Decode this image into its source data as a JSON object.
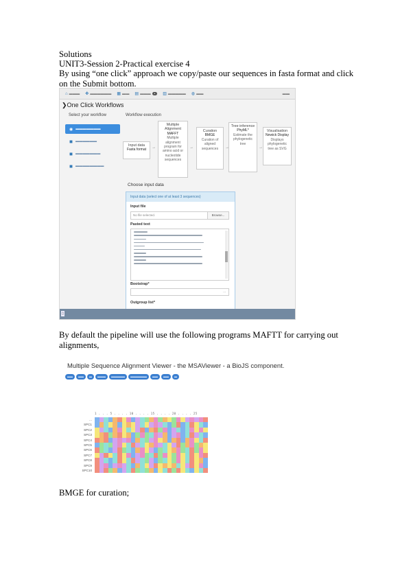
{
  "document": {
    "heading": "Solutions",
    "subheading": "UNIT3-Session 2-Practical exercise 4",
    "intro": "By using “one click” approach we copy/paste our sequences in fasta format and click on the Submit bottom.",
    "pipeline_text": "By default the pipeline will use the following programs MAFTT for carrying out alignments,",
    "bmge_text": "BMGE for curation;"
  },
  "screenshot1": {
    "page_title": "One Click Workflows",
    "sidebar_title": "Select your workflow",
    "workflow_title": "Workflow execution",
    "input_label": "Choose input data",
    "panel_header": "Input data (select one of at least 3 sequences)",
    "input_file_label": "Input file",
    "file_placeholder": "No file selected.",
    "file_button": "Browse...",
    "pasted_label": "Pasted text",
    "bootstrap_label": "Bootstrap*",
    "bootstrap_value": "...",
    "outgroup_label": "Outgroup list*",
    "colors": {
      "accent": "#3c8dde",
      "panel_border": "#a8cbe8",
      "bottom_bar": "#7389a1"
    },
    "workflow_steps": [
      {
        "step": "Input data",
        "program": "Fasta format",
        "desc": ""
      },
      {
        "step": "Multiple Alignment",
        "program": "MAFFT",
        "desc": "Multiple alignment program for amino acid or nucleotide sequences"
      },
      {
        "step": "Curation",
        "program": "BMGE",
        "desc": "Curation of aligned sequences"
      },
      {
        "step": "Tree inference",
        "program": "PhyML*",
        "desc": "Estimate the phylogenetic tree"
      },
      {
        "step": "Visualisation",
        "program": "Newick Display",
        "desc": "Displays phylogenetic tree as SVG"
      }
    ]
  },
  "screenshot2": {
    "title": "Multiple Sequence Alignment Viewer - the MSAViewer - a BioJS component.",
    "seq_names": [
      "...",
      "SPC1",
      "SPC2",
      "SPC3",
      "SPC4",
      "SPC5",
      "SPC6",
      "SPC7",
      "SPC8",
      "SPC9",
      "SPC10"
    ],
    "ruler": "1 . . . 5 . . . . 10 . . . . 15 . . . . 20 . . . . 25"
  }
}
